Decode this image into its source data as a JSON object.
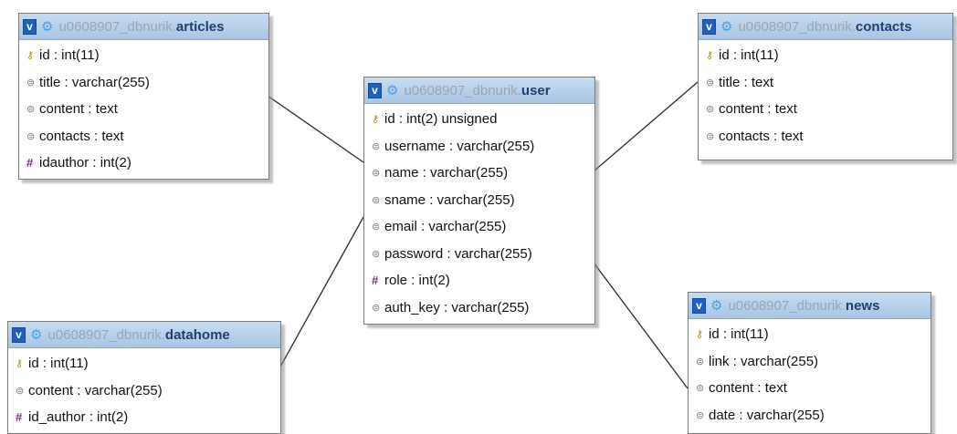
{
  "links": [
    {
      "from": "articles",
      "to": "user"
    },
    {
      "from": "contacts",
      "to": "user"
    },
    {
      "from": "datahome",
      "to": "user"
    },
    {
      "from": "news",
      "to": "user"
    }
  ],
  "tables": {
    "articles": {
      "db": "u0608907_dbnurik.",
      "name": "articles",
      "columns": [
        {
          "icon": "key-icon",
          "text": "id : int(11)"
        },
        {
          "icon": "text-column-icon",
          "text": "title : varchar(255)"
        },
        {
          "icon": "text-column-icon",
          "text": "content : text"
        },
        {
          "icon": "text-column-icon",
          "text": "contacts : text"
        },
        {
          "icon": "numeric-column-icon",
          "text": "idauthor : int(2)"
        }
      ]
    },
    "user": {
      "db": "u0608907_dbnurik.",
      "name": "user",
      "columns": [
        {
          "icon": "key-icon",
          "text": "id : int(2) unsigned"
        },
        {
          "icon": "text-column-icon",
          "text": "username : varchar(255)"
        },
        {
          "icon": "text-column-icon",
          "text": "name : varchar(255)"
        },
        {
          "icon": "text-column-icon",
          "text": "sname : varchar(255)"
        },
        {
          "icon": "text-column-icon",
          "text": "email : varchar(255)"
        },
        {
          "icon": "text-column-icon",
          "text": "password : varchar(255)"
        },
        {
          "icon": "numeric-column-icon",
          "text": "role : int(2)"
        },
        {
          "icon": "text-column-icon",
          "text": "auth_key : varchar(255)"
        }
      ]
    },
    "contacts": {
      "db": "u0608907_dbnurik.",
      "name": "contacts",
      "columns": [
        {
          "icon": "key-icon",
          "text": "id : int(11)"
        },
        {
          "icon": "text-column-icon",
          "text": "title : text"
        },
        {
          "icon": "text-column-icon",
          "text": "content : text"
        },
        {
          "icon": "text-column-icon",
          "text": "contacts : text"
        }
      ]
    },
    "datahome": {
      "db": "u0608907_dbnurik.",
      "name": "datahome",
      "columns": [
        {
          "icon": "key-icon",
          "text": "id : int(11)"
        },
        {
          "icon": "text-column-icon",
          "text": "content : varchar(255)"
        },
        {
          "icon": "numeric-column-icon",
          "text": "id_author : int(2)"
        }
      ]
    },
    "news": {
      "db": "u0608907_dbnurik.",
      "name": "news",
      "columns": [
        {
          "icon": "key-icon",
          "text": "id : int(11)"
        },
        {
          "icon": "text-column-icon",
          "text": "link : varchar(255)"
        },
        {
          "icon": "text-column-icon",
          "text": "content : text"
        },
        {
          "icon": "text-column-icon",
          "text": "date : varchar(255)"
        }
      ]
    }
  }
}
